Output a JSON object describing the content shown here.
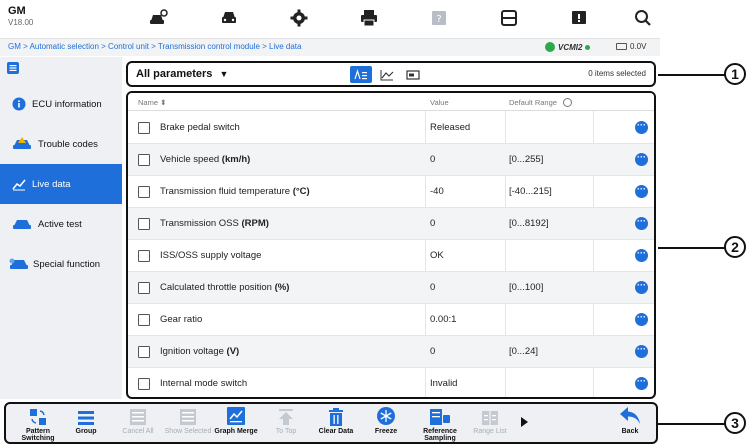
{
  "header": {
    "brand": "GM",
    "version": "V18.00",
    "icons": [
      "car-diagnose-icon",
      "car-icon",
      "settings-gear-icon",
      "print-icon",
      "help-icon",
      "save-icon",
      "feedback-icon",
      "search-icon"
    ]
  },
  "breadcrumb": {
    "path": "GM > Automatic selection > Control unit > Transmission control module > Live data",
    "vci": "VCMI2",
    "voltage": "0.0V"
  },
  "sidebar": {
    "items": [
      {
        "label": "ECU information",
        "icon": "info-icon"
      },
      {
        "label": "Trouble codes",
        "icon": "car-warning-icon"
      },
      {
        "label": "Live data",
        "icon": "line-chart-icon"
      },
      {
        "label": "Active test",
        "icon": "car-test-icon"
      },
      {
        "label": "Special function",
        "icon": "car-special-icon"
      }
    ],
    "active_index": 2
  },
  "toolbar": {
    "filter_label": "All parameters",
    "selected_count": "0 items selected"
  },
  "table": {
    "columns": {
      "name": "Name",
      "value": "Value",
      "range": "Default Range"
    },
    "rows": [
      {
        "name": "Brake pedal switch",
        "unit": "",
        "value": "Released",
        "range": ""
      },
      {
        "name": "Vehicle speed ",
        "unit": "(km/h)",
        "value": "0",
        "range": "[0...255]"
      },
      {
        "name": "Transmission fluid temperature ",
        "unit": "(°C)",
        "value": "-40",
        "range": "[-40...215]"
      },
      {
        "name": "Transmission OSS ",
        "unit": "(RPM)",
        "value": "0",
        "range": "[0...8192]"
      },
      {
        "name": "ISS/OSS supply voltage",
        "unit": "",
        "value": "OK",
        "range": ""
      },
      {
        "name": "Calculated throttle position ",
        "unit": "(%)",
        "value": "0",
        "range": "[0...100]"
      },
      {
        "name": "Gear ratio",
        "unit": "",
        "value": "0.00:1",
        "range": ""
      },
      {
        "name": "Ignition voltage ",
        "unit": "(V)",
        "value": "0",
        "range": "[0...24]"
      },
      {
        "name": "Internal mode switch",
        "unit": "",
        "value": "Invalid",
        "range": ""
      }
    ]
  },
  "bottom_bar": {
    "buttons": [
      {
        "label": "Pattern Switching",
        "enabled": true
      },
      {
        "label": "Group",
        "enabled": true
      },
      {
        "label": "Cancel All",
        "enabled": false
      },
      {
        "label": "Show Selected",
        "enabled": false
      },
      {
        "label": "Graph Merge",
        "enabled": true
      },
      {
        "label": "To Top",
        "enabled": false
      },
      {
        "label": "Clear Data",
        "enabled": true
      },
      {
        "label": "Freeze",
        "enabled": true
      },
      {
        "label": "Reference Sampling",
        "enabled": true
      },
      {
        "label": "Range List",
        "enabled": false
      },
      {
        "label": "Back",
        "enabled": true
      }
    ]
  },
  "callouts": [
    "1",
    "2",
    "3"
  ],
  "colors": {
    "accent": "#1e6fd9",
    "sidebar_bg": "#eef0f3",
    "disabled": "#a8adb5"
  }
}
